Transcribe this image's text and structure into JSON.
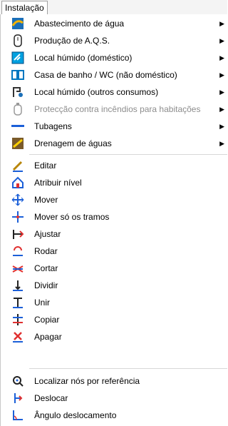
{
  "menubar": {
    "title": "Instalação"
  },
  "menu": {
    "group1": [
      {
        "label": "Abastecimento de água",
        "icon": "water-supply-icon",
        "submenu": true,
        "enabled": true
      },
      {
        "label": "Produção de A.Q.S.",
        "icon": "water-heater-icon",
        "submenu": true,
        "enabled": true
      },
      {
        "label": "Local húmido (doméstico)",
        "icon": "domestic-wet-room-icon",
        "submenu": true,
        "enabled": true
      },
      {
        "label": "Casa de banho / WC (não doméstico)",
        "icon": "bathroom-wc-icon",
        "submenu": true,
        "enabled": true
      },
      {
        "label": "Local húmido (outros consumos)",
        "icon": "other-consumption-icon",
        "submenu": true,
        "enabled": true
      },
      {
        "label": "Protecção contra incêndios para habitações",
        "icon": "fire-protection-icon",
        "submenu": true,
        "enabled": false
      },
      {
        "label": "Tubagens",
        "icon": "pipes-icon",
        "submenu": true,
        "enabled": true
      },
      {
        "label": "Drenagem de águas",
        "icon": "drainage-icon",
        "submenu": true,
        "enabled": true
      }
    ],
    "group2": [
      {
        "label": "Editar",
        "icon": "pencil-edit-icon"
      },
      {
        "label": "Atribuir nível",
        "icon": "assign-level-icon"
      },
      {
        "label": "Mover",
        "icon": "move-arrows-icon"
      },
      {
        "label": "Mover só os tramos",
        "icon": "move-segments-icon"
      },
      {
        "label": "Ajustar",
        "icon": "adjust-icon"
      },
      {
        "label": "Rodar",
        "icon": "rotate-icon"
      },
      {
        "label": "Cortar",
        "icon": "cut-icon"
      },
      {
        "label": "Dividir",
        "icon": "divide-icon"
      },
      {
        "label": "Unir",
        "icon": "join-icon"
      },
      {
        "label": "Copiar",
        "icon": "copy-icon"
      },
      {
        "label": "Apagar",
        "icon": "delete-icon"
      }
    ],
    "group3": [
      {
        "label": "Localizar nós por referência",
        "icon": "locate-nodes-icon"
      },
      {
        "label": "Deslocar",
        "icon": "displace-icon"
      },
      {
        "label": "Ângulo deslocamento",
        "icon": "angle-displacement-icon"
      }
    ]
  }
}
